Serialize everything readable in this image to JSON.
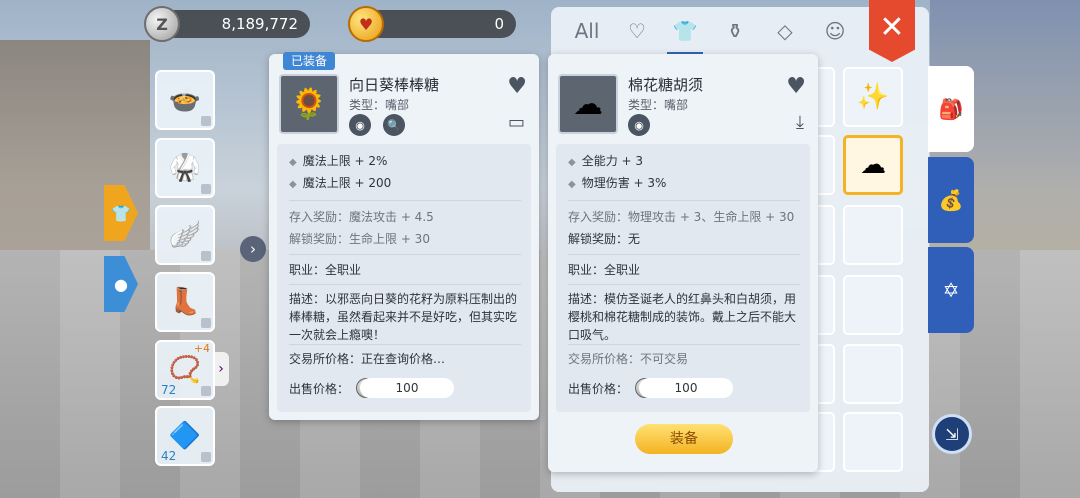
{
  "currency": {
    "zeny": "8,189,772",
    "hearts": "0"
  },
  "tabs": [
    "All",
    "heart-icon",
    "shirt-icon",
    "bag-icon",
    "gem-icon",
    "face-icon"
  ],
  "left_card": {
    "badge": "已装备",
    "name": "向日葵棒棒糖",
    "type": "类型：嘴部",
    "stats": [
      "魔法上限 + 2%",
      "魔法上限 + 200"
    ],
    "deposit_reward": "存入奖励：魔法攻击 + 4.5",
    "unlock_reward": "解锁奖励：生命上限 + 30",
    "job": "职业：全职业",
    "desc": "描述：以邪恶向日葵的花籽为原料压制出的棒棒糖，虽然看起来并不是好吃，但其实吃一次就会上瘾噢！",
    "market": "交易所价格：正在查询价格…",
    "sell_label": "出售价格：",
    "sell_price": "100"
  },
  "right_card": {
    "name": "棉花糖胡须",
    "type": "类型：嘴部",
    "stats": [
      "全能力 + 3",
      "物理伤害 + 3%"
    ],
    "deposit_reward": "存入奖励：物理攻击 + 3、生命上限 + 30",
    "unlock_reward": "解锁奖励：无",
    "job": "职业：全职业",
    "desc": "描述：模仿圣诞老人的红鼻头和白胡须，用樱桃和棉花糖制成的装饰。戴上之后不能大口吸气。",
    "market": "交易所价格：不可交易",
    "sell_label": "出售价格：",
    "sell_price": "100",
    "equip_button": "装备"
  },
  "left_items": [
    {
      "icon": "cauldron-icon",
      "count": ""
    },
    {
      "icon": "robe-icon",
      "count": ""
    },
    {
      "icon": "wings-icon",
      "count": ""
    },
    {
      "icon": "boots-icon",
      "count": ""
    },
    {
      "icon": "necklace-icon",
      "count": "72",
      "plus": "+4"
    },
    {
      "icon": "crystal-icon",
      "count": "42"
    }
  ],
  "close_label": "✕"
}
